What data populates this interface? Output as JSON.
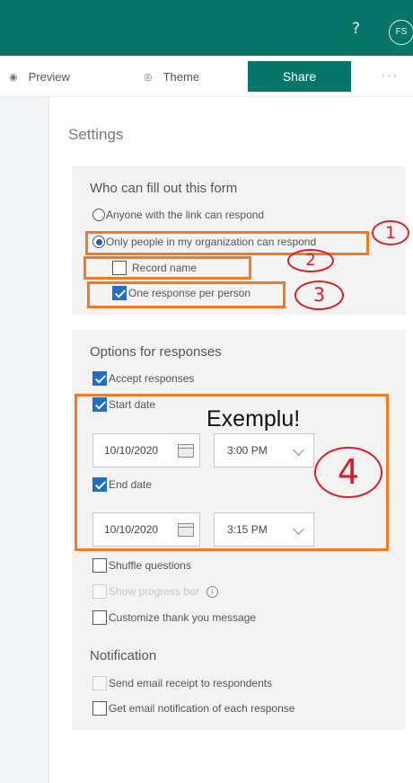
{
  "topbar": {
    "help_icon": "?",
    "avatar_initials": "FS",
    "color": "#077568"
  },
  "toolbar": {
    "preview": {
      "icon": "eye-icon",
      "label": "Preview"
    },
    "theme": {
      "icon": "palette-icon",
      "label": "Theme"
    },
    "share_label": "Share",
    "more": "···"
  },
  "settings": {
    "title": "Settings",
    "who": {
      "heading": "Who can fill out this form",
      "anyone_label": "Anyone with the link can respond",
      "org_label": "Only people in my organization can respond",
      "selected": "org",
      "record_name_label": "Record name",
      "record_name_checked": false,
      "one_response_label": "One response per person",
      "one_response_checked": true
    },
    "options": {
      "heading": "Options for responses",
      "accept_label": "Accept responses",
      "accept_checked": true,
      "start_label": "Start date",
      "start_checked": true,
      "start_date": "10/10/2020",
      "start_time": "3:00 PM",
      "end_label": "End date",
      "end_checked": true,
      "end_date": "10/10/2020",
      "end_time": "3:15 PM",
      "shuffle_label": "Shuffle questions",
      "shuffle_checked": false,
      "progress_label": "Show progress bar",
      "progress_disabled": true,
      "thankyou_label": "Customize thank you message",
      "thankyou_checked": false
    },
    "notification": {
      "heading": "Notification",
      "email_receipt_label": "Send email receipt to respondents",
      "email_receipt_disabled": true,
      "notify_label": "Get email notification of each response",
      "notify_checked": false
    }
  },
  "annotations": {
    "example_text": "Exemplu!",
    "marks": [
      "1",
      "2",
      "3",
      "4"
    ],
    "box_color": "#f07b26",
    "ink_color": "#d91f26"
  }
}
